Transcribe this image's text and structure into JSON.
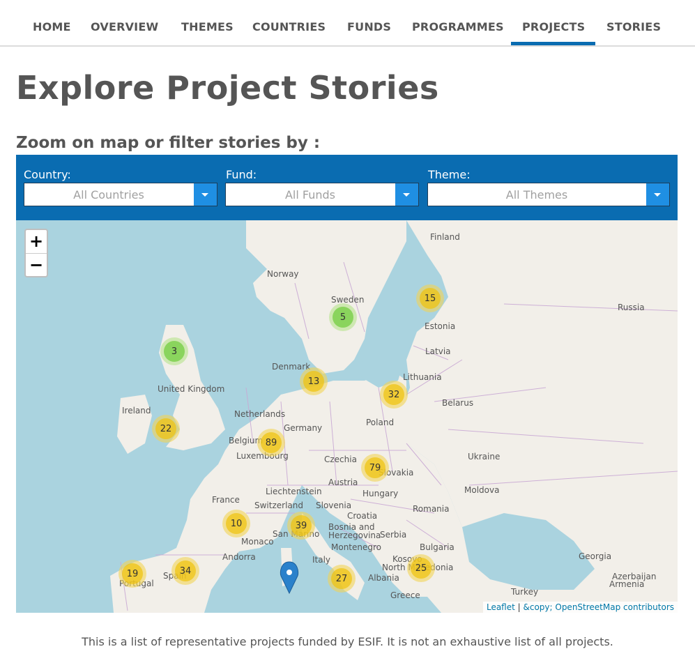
{
  "nav": {
    "items": [
      "HOME",
      "OVERVIEW",
      "THEMES",
      "COUNTRIES",
      "FUNDS",
      "PROGRAMMES",
      "PROJECTS",
      "STORIES"
    ],
    "active": "PROJECTS",
    "accent": "#0a6cb1"
  },
  "page_title": "Explore Project Stories",
  "subheading": "Zoom on map or filter stories by :",
  "filters": {
    "country": {
      "label": "Country:",
      "value": "All Countries"
    },
    "fund": {
      "label": "Fund:",
      "value": "All Funds"
    },
    "theme": {
      "label": "Theme:",
      "value": "All Themes"
    }
  },
  "map": {
    "zoom_in": "+",
    "zoom_out": "−",
    "labels": {
      "finland": "Finland",
      "norway": "Norway",
      "sweden": "Sweden",
      "russia": "Russia",
      "estonia": "Estonia",
      "latvia": "Latvia",
      "denmark": "Denmark",
      "lithuania": "Lithuania",
      "united_kingdom": "United Kingdom",
      "belarus": "Belarus",
      "ireland": "Ireland",
      "netherlands": "Netherlands",
      "poland": "Poland",
      "germany": "Germany",
      "belgium": "Belgium",
      "luxembourg": "Luxembourg",
      "czechia": "Czechia",
      "slovakia": "Slovakia",
      "ukraine": "Ukraine",
      "austria": "Austria",
      "liechtenstein": "Liechtenstein",
      "hungary": "Hungary",
      "moldova": "Moldova",
      "france": "France",
      "switzerland": "Switzerland",
      "slovenia": "Slovenia",
      "croatia": "Croatia",
      "romania": "Romania",
      "bosnia": "Bosnia and\nHerzegovina",
      "serbia": "Serbia",
      "monaco": "Monaco",
      "san_marino": "San Marino",
      "montenegro": "Montenegro",
      "bulgaria": "Bulgaria",
      "georgia": "Georgia",
      "andorra": "Andorra",
      "italy": "Italy",
      "kosovo": "Kosovo",
      "north_macedonia": "North Macedonia",
      "albania": "Albania",
      "azerbaijan": "Azerbaijan",
      "armenia": "Armenia",
      "spain": "Spain",
      "portugal": "Portugal",
      "greece": "Greece",
      "turkey": "Turkey"
    },
    "clusters": [
      {
        "count": "15",
        "color": "yellow"
      },
      {
        "count": "5",
        "color": "green"
      },
      {
        "count": "3",
        "color": "green"
      },
      {
        "count": "13",
        "color": "yellow"
      },
      {
        "count": "32",
        "color": "yellow"
      },
      {
        "count": "22",
        "color": "yellow"
      },
      {
        "count": "89",
        "color": "yellow"
      },
      {
        "count": "79",
        "color": "yellow"
      },
      {
        "count": "10",
        "color": "yellow"
      },
      {
        "count": "39",
        "color": "yellow"
      },
      {
        "count": "19",
        "color": "yellow"
      },
      {
        "count": "34",
        "color": "yellow"
      },
      {
        "count": "27",
        "color": "yellow"
      },
      {
        "count": "25",
        "color": "yellow"
      }
    ],
    "attribution": {
      "leaflet": "Leaflet",
      "sep": " | ",
      "osm": "&copy; OpenStreetMap contributors"
    }
  },
  "footer_note": "This is a list of representative projects funded by ESIF. It is not an exhaustive list of all projects."
}
